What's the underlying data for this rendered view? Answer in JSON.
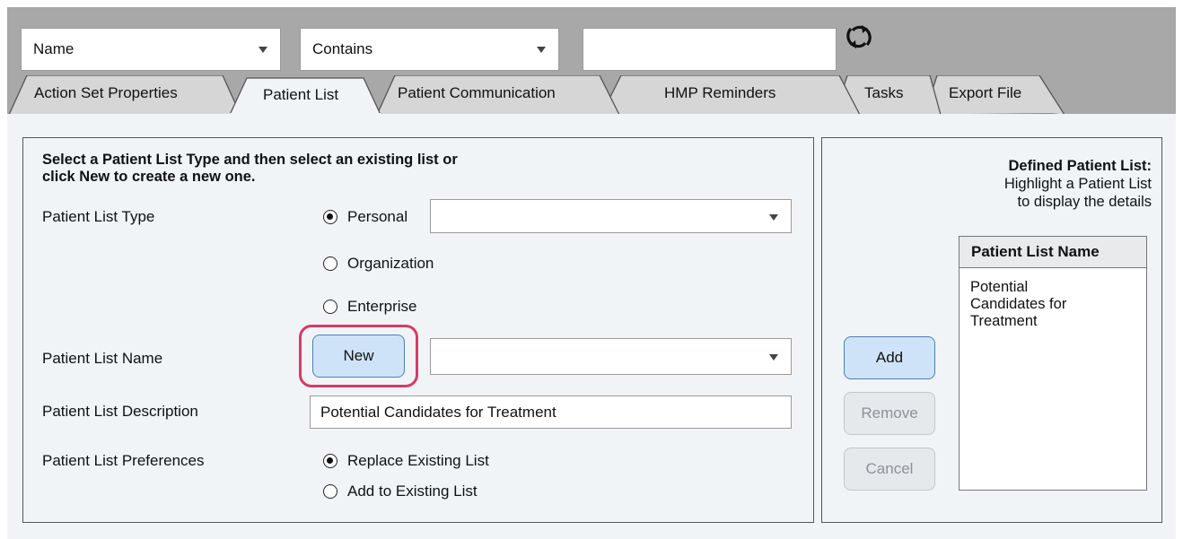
{
  "filter": {
    "field_value": "Name",
    "operator_value": "Contains",
    "search_value": ""
  },
  "tabs": [
    {
      "label": "Action Set Properties"
    },
    {
      "label": "Patient List",
      "active": true
    },
    {
      "label": "Patient Communication"
    },
    {
      "label": "HMP Reminders"
    },
    {
      "label": "Tasks"
    },
    {
      "label": "Export File"
    }
  ],
  "left_panel": {
    "instruction_line1": "Select a Patient List Type and then select an existing list or",
    "instruction_line2": "click New to create a new one.",
    "type_label": "Patient List Type",
    "type_options": [
      "Personal",
      "Organization",
      "Enterprise"
    ],
    "type_selected": "Personal",
    "type_dropdown_value": "",
    "name_label": "Patient List Name",
    "new_button": "New",
    "name_dropdown_value": "",
    "description_label": "Patient List Description",
    "description_value": "Potential Candidates for Treatment",
    "preferences_label": "Patient List Preferences",
    "preference_options": [
      "Replace Existing List",
      "Add to Existing List"
    ],
    "preference_selected": "Replace Existing List"
  },
  "buttons": {
    "add": "Add",
    "remove": "Remove",
    "cancel": "Cancel"
  },
  "right_panel": {
    "title": "Defined Patient List:",
    "subtitle_line1": "Highlight a Patient List",
    "subtitle_line2": "to display the details",
    "column_header": "Patient List Name",
    "item_line1": "Potential",
    "item_line2": "Candidates for",
    "item_line3": "Treatment"
  },
  "colors": {
    "highlight": "#d83a64",
    "button_active": "#cfe3f8",
    "frame_gray": "#a8a8a9"
  }
}
